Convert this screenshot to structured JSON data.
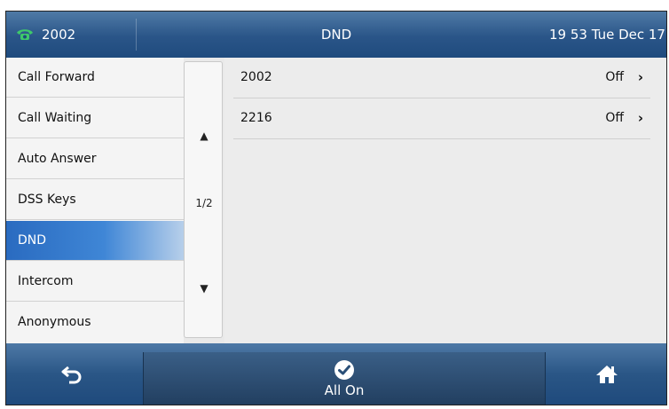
{
  "topbar": {
    "account": "2002",
    "title": "DND",
    "clock": "19 53 Tue Dec 17"
  },
  "menu": {
    "items": [
      {
        "label": "Call Forward"
      },
      {
        "label": "Call Waiting"
      },
      {
        "label": "Auto Answer"
      },
      {
        "label": "DSS Keys"
      },
      {
        "label": "DND"
      },
      {
        "label": "Intercom"
      },
      {
        "label": "Anonymous"
      }
    ],
    "active": "DND"
  },
  "pager": {
    "up": "▲",
    "page": "1/2",
    "down": "▼"
  },
  "content": {
    "rows": [
      {
        "label": "2002",
        "value": "Off",
        "chevron": "›"
      },
      {
        "label": "2216",
        "value": "Off",
        "chevron": "›"
      }
    ]
  },
  "softkeys": {
    "back_icon": "back-arrow-icon",
    "center_label": "All On",
    "center_icon": "check-circle-icon",
    "home_icon": "home-icon"
  },
  "colors": {
    "bar": "#2a5688",
    "active_item": "#2a6bc0",
    "phone_icon": "#3ec96a"
  }
}
